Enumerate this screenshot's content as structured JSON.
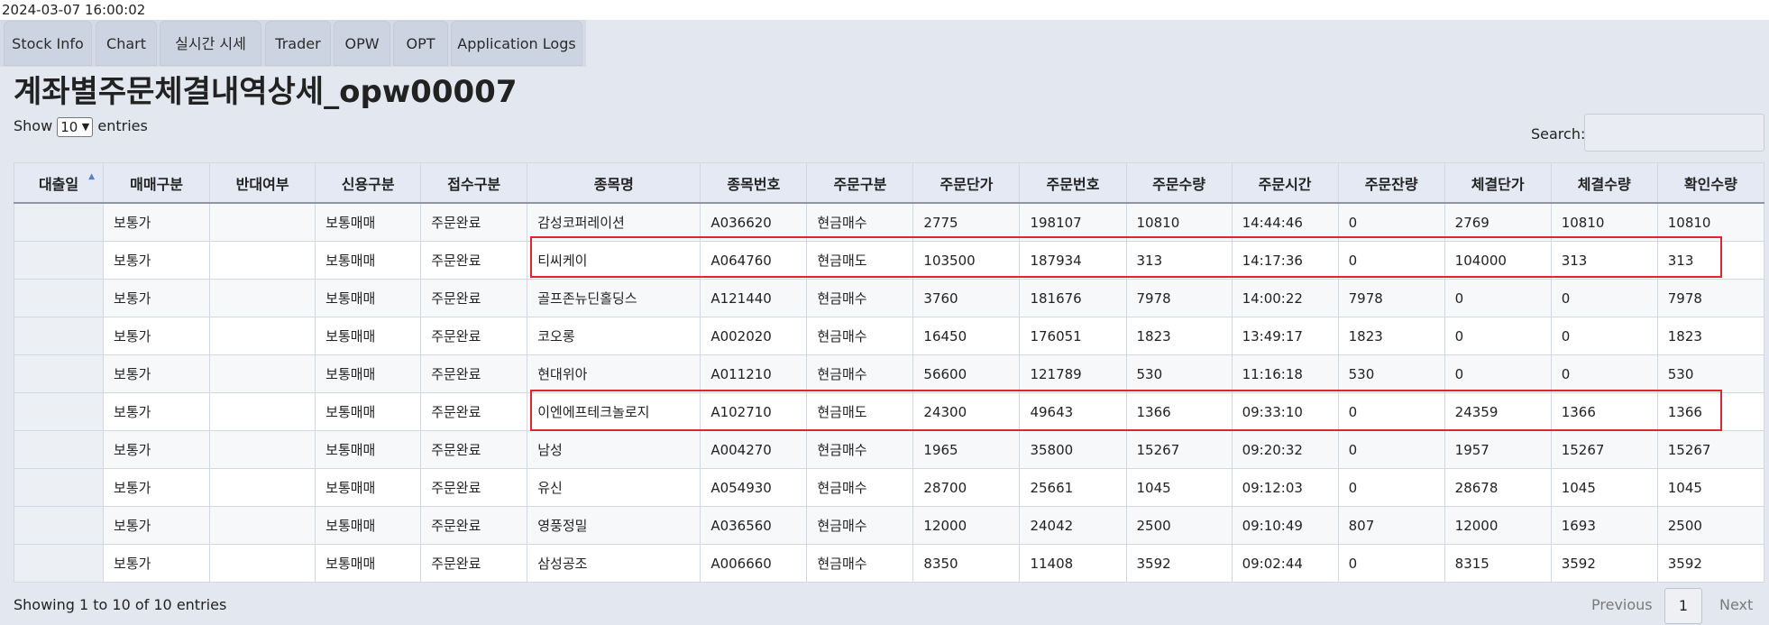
{
  "timestamp": "2024-03-07 16:00:02",
  "tabs": [
    {
      "label": "Stock Info"
    },
    {
      "label": "Chart"
    },
    {
      "label": "실시간 시세"
    },
    {
      "label": "Trader"
    },
    {
      "label": "OPW"
    },
    {
      "label": "OPT"
    },
    {
      "label": "Application Logs"
    }
  ],
  "page_title": "계좌별주문체결내역상세_opw00007",
  "length_control": {
    "show": "Show",
    "value": "10",
    "entries": "entries"
  },
  "search": {
    "label": "Search:",
    "value": ""
  },
  "table": {
    "columns": [
      "대출일",
      "매매구분",
      "반대여부",
      "신용구분",
      "접수구분",
      "종목명",
      "종목번호",
      "주문구분",
      "주문단가",
      "주문번호",
      "주문수량",
      "주문시간",
      "주문잔량",
      "체결단가",
      "체결수량",
      "확인수량"
    ],
    "sorted_column": "대출일",
    "rows": [
      [
        "",
        "보통가",
        "",
        "보통매매",
        "주문완료",
        "감성코퍼레이션",
        "A036620",
        "현금매수",
        "2775",
        "198107",
        "10810",
        "14:44:46",
        "0",
        "2769",
        "10810",
        "10810"
      ],
      [
        "",
        "보통가",
        "",
        "보통매매",
        "주문완료",
        "티씨케이",
        "A064760",
        "현금매도",
        "103500",
        "187934",
        "313",
        "14:17:36",
        "0",
        "104000",
        "313",
        "313"
      ],
      [
        "",
        "보통가",
        "",
        "보통매매",
        "주문완료",
        "골프존뉴딘홀딩스",
        "A121440",
        "현금매수",
        "3760",
        "181676",
        "7978",
        "14:00:22",
        "7978",
        "0",
        "0",
        "7978"
      ],
      [
        "",
        "보통가",
        "",
        "보통매매",
        "주문완료",
        "코오롱",
        "A002020",
        "현금매수",
        "16450",
        "176051",
        "1823",
        "13:49:17",
        "1823",
        "0",
        "0",
        "1823"
      ],
      [
        "",
        "보통가",
        "",
        "보통매매",
        "주문완료",
        "현대위아",
        "A011210",
        "현금매수",
        "56600",
        "121789",
        "530",
        "11:16:18",
        "530",
        "0",
        "0",
        "530"
      ],
      [
        "",
        "보통가",
        "",
        "보통매매",
        "주문완료",
        "이엔에프테크놀로지",
        "A102710",
        "현금매도",
        "24300",
        "49643",
        "1366",
        "09:33:10",
        "0",
        "24359",
        "1366",
        "1366"
      ],
      [
        "",
        "보통가",
        "",
        "보통매매",
        "주문완료",
        "남성",
        "A004270",
        "현금매수",
        "1965",
        "35800",
        "15267",
        "09:20:32",
        "0",
        "1957",
        "15267",
        "15267"
      ],
      [
        "",
        "보통가",
        "",
        "보통매매",
        "주문완료",
        "유신",
        "A054930",
        "현금매수",
        "28700",
        "25661",
        "1045",
        "09:12:03",
        "0",
        "28678",
        "1045",
        "1045"
      ],
      [
        "",
        "보통가",
        "",
        "보통매매",
        "주문완료",
        "영풍정밀",
        "A036560",
        "현금매수",
        "12000",
        "24042",
        "2500",
        "09:10:49",
        "807",
        "12000",
        "1693",
        "2500"
      ],
      [
        "",
        "보통가",
        "",
        "보통매매",
        "주문완료",
        "삼성공조",
        "A006660",
        "현금매수",
        "8350",
        "11408",
        "3592",
        "09:02:44",
        "0",
        "8315",
        "3592",
        "3592"
      ]
    ]
  },
  "info": "Showing 1 to 10 of 10 entries",
  "pagination": {
    "previous": "Previous",
    "page": "1",
    "next": "Next"
  },
  "colors": {
    "highlight": "#e0262b",
    "background": "#e3e7ef",
    "tab": "#ccd4e1"
  }
}
